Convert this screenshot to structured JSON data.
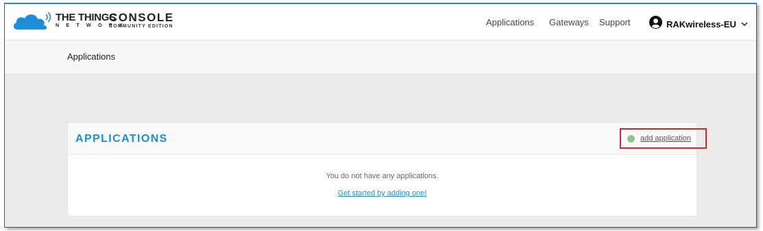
{
  "header": {
    "brand_top": "THE THINGS",
    "brand_bottom": "N E T W O R K",
    "console_title": "CONSOLE",
    "console_subtitle": "COMMUNITY EDITION",
    "nav": [
      "Applications",
      "Gateways",
      "Support"
    ],
    "user_name": "RAKwireless-EU"
  },
  "breadcrumb": {
    "label": "Applications"
  },
  "applications_card": {
    "title": "APPLICATIONS",
    "add_label": "add application",
    "empty_message": "You do not have any applications.",
    "get_started_link": "Get started by adding one!"
  },
  "colors": {
    "accent": "#1f8dd6",
    "highlight_box": "#d9232e",
    "add_dot": "#8bc98a"
  },
  "icons": {
    "logo": "cloud-logo-icon",
    "user": "user-avatar-icon",
    "dropdown": "chevron-down-icon",
    "add": "plus-circle-icon"
  }
}
